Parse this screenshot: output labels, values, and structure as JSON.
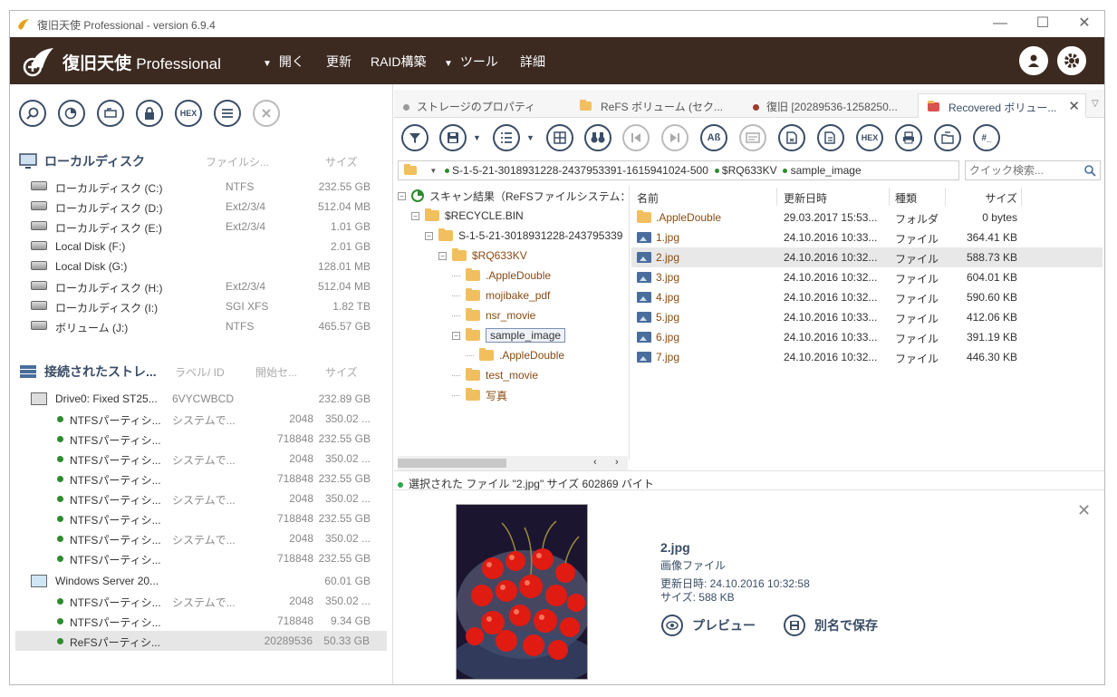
{
  "window": {
    "title": "復旧天使 Professional - version 6.9.4"
  },
  "brand": {
    "name": "復旧天使",
    "edition": "Professional"
  },
  "menu": [
    {
      "label": "開く",
      "arrow": "▼"
    },
    {
      "label": "更新",
      "arrow": ""
    },
    {
      "label": "RAID構築",
      "arrow": ""
    },
    {
      "label": "ツール",
      "arrow": "▼"
    },
    {
      "label": "詳細",
      "arrow": ""
    }
  ],
  "left_toolbar": [
    {
      "icon": "search-icon"
    },
    {
      "icon": "scan-icon"
    },
    {
      "icon": "image-file-icon"
    },
    {
      "icon": "lock-icon"
    },
    {
      "icon": "hex-icon",
      "label": "HEX"
    },
    {
      "icon": "list-icon"
    },
    {
      "icon": "close-icon"
    }
  ],
  "local_disks": {
    "title": "ローカルディスク",
    "col_fs": "ファイルシ...",
    "col_size": "サイズ",
    "items": [
      {
        "name": "ローカルディスク (C:)",
        "fs": "NTFS",
        "size": "232.55 GB"
      },
      {
        "name": "ローカルディスク (D:)",
        "fs": "Ext2/3/4",
        "size": "512.04 MB"
      },
      {
        "name": "ローカルディスク (E:)",
        "fs": "Ext2/3/4",
        "size": "1.01 GB"
      },
      {
        "name": "Local Disk (F:)",
        "fs": "",
        "size": "2.01 GB"
      },
      {
        "name": "Local Disk (G:)",
        "fs": "",
        "size": "128.01 MB"
      },
      {
        "name": "ローカルディスク (H:)",
        "fs": "Ext2/3/4",
        "size": "512.04 MB"
      },
      {
        "name": "ローカルディスク (I:)",
        "fs": "SGI XFS",
        "size": "1.82 TB"
      },
      {
        "name": "ボリューム (J:)",
        "fs": "NTFS",
        "size": "465.57 GB"
      }
    ]
  },
  "storages": {
    "title": "接続されたストレ...",
    "col_label": "ラベル/ ID",
    "col_start": "開始セ...",
    "col_size": "サイズ",
    "items": [
      {
        "type": "drive",
        "name": "Drive0: Fixed ST25...",
        "label": "6VYCWBCD",
        "start": "",
        "size": "232.89 GB"
      },
      {
        "type": "part",
        "name": "NTFSパーティシ...",
        "label": "システムで...",
        "start": "2048",
        "size": "350.02 ..."
      },
      {
        "type": "part",
        "name": "NTFSパーティシ...",
        "label": "",
        "start": "718848",
        "size": "232.55 GB"
      },
      {
        "type": "part",
        "name": "NTFSパーティシ...",
        "label": "システムで...",
        "start": "2048",
        "size": "350.02 ..."
      },
      {
        "type": "part",
        "name": "NTFSパーティシ...",
        "label": "",
        "start": "718848",
        "size": "232.55 GB"
      },
      {
        "type": "part",
        "name": "NTFSパーティシ...",
        "label": "システムで...",
        "start": "2048",
        "size": "350.02 ..."
      },
      {
        "type": "part",
        "name": "NTFSパーティシ...",
        "label": "",
        "start": "718848",
        "size": "232.55 GB"
      },
      {
        "type": "part",
        "name": "NTFSパーティシ...",
        "label": "システムで...",
        "start": "2048",
        "size": "350.02 ..."
      },
      {
        "type": "part",
        "name": "NTFSパーティシ...",
        "label": "",
        "start": "718848",
        "size": "232.55 GB"
      },
      {
        "type": "vdrive",
        "name": "Windows Server 20...",
        "label": "",
        "start": "",
        "size": "60.01 GB"
      },
      {
        "type": "part",
        "name": "NTFSパーティシ...",
        "label": "システムで...",
        "start": "2048",
        "size": "350.02 ..."
      },
      {
        "type": "part",
        "name": "NTFSパーティシ...",
        "label": "",
        "start": "718848",
        "size": "9.34 GB"
      },
      {
        "type": "part",
        "name": "ReFSパーティシ...",
        "label": "",
        "start": "20289536",
        "size": "50.33 GB",
        "selected": true
      }
    ]
  },
  "tabs": [
    {
      "label": "ストレージのプロパティ",
      "icon": "dot-icon"
    },
    {
      "label": "ReFS ボリューム (セク...",
      "icon": "folder-icon"
    },
    {
      "label": "復旧 [20289536-1258250...",
      "icon": "dot-red-icon"
    },
    {
      "label": "Recovered ボリュー...",
      "icon": "folder-red-icon",
      "active": true
    }
  ],
  "right_toolbar": [
    {
      "icon": "filter-icon"
    },
    {
      "icon": "save-icon"
    },
    {
      "icon": "checklist-icon"
    },
    {
      "icon": "grid-view-icon"
    },
    {
      "icon": "binoculars-icon"
    },
    {
      "icon": "prev-icon"
    },
    {
      "icon": "next-icon"
    },
    {
      "icon": "text-icon",
      "label": "Aß"
    },
    {
      "icon": "card-icon"
    },
    {
      "icon": "file-export-icon"
    },
    {
      "icon": "file-copy-icon"
    },
    {
      "icon": "hex-icon",
      "label": "HEX"
    },
    {
      "icon": "print-icon"
    },
    {
      "icon": "folder-copy-icon"
    },
    {
      "icon": "hash-icon",
      "label": "#_"
    }
  ],
  "path": {
    "seg1": "S-1-5-21-3018931228-2437953391-1615941024-500",
    "seg2": "$RQ633KV",
    "seg3": "sample_image"
  },
  "search": {
    "placeholder": "クイック検索..."
  },
  "tree": [
    {
      "label": "スキャン結果（ReFSファイルシステム：",
      "level": 0,
      "toggle": "⊟",
      "type": "root"
    },
    {
      "label": "$RECYCLE.BIN",
      "level": 1,
      "toggle": "⊟",
      "type": "folder"
    },
    {
      "label": "S-1-5-21-3018931228-243795339",
      "level": 2,
      "toggle": "⊟",
      "type": "folder"
    },
    {
      "label": "$RQ633KV",
      "level": 3,
      "toggle": "⊟",
      "type": "folder"
    },
    {
      "label": ".AppleDouble",
      "level": 4,
      "toggle": "",
      "type": "folder"
    },
    {
      "label": "mojibake_pdf",
      "level": 4,
      "toggle": "",
      "type": "folder"
    },
    {
      "label": "nsr_movie",
      "level": 4,
      "toggle": "",
      "type": "folder"
    },
    {
      "label": "sample_image",
      "level": 4,
      "toggle": "⊟",
      "type": "folder",
      "selected": true
    },
    {
      "label": ".AppleDouble",
      "level": 5,
      "toggle": "",
      "type": "folder"
    },
    {
      "label": "test_movie",
      "level": 4,
      "toggle": "",
      "type": "folder"
    },
    {
      "label": "写真",
      "level": 4,
      "toggle": "",
      "type": "folder"
    }
  ],
  "files": {
    "headers": {
      "name": "名前",
      "date": "更新日時",
      "type": "種類",
      "size": "サイズ"
    },
    "rows": [
      {
        "name": ".AppleDouble",
        "date": "29.03.2017 15:53...",
        "type": "フォルダ",
        "size": "0 bytes",
        "kind": "folder"
      },
      {
        "name": "1.jpg",
        "date": "24.10.2016 10:33...",
        "type": "ファイル",
        "size": "364.41 KB",
        "kind": "image"
      },
      {
        "name": "2.jpg",
        "date": "24.10.2016 10:32...",
        "type": "ファイル",
        "size": "588.73 KB",
        "kind": "image",
        "selected": true
      },
      {
        "name": "3.jpg",
        "date": "24.10.2016 10:32...",
        "type": "ファイル",
        "size": "604.01 KB",
        "kind": "image"
      },
      {
        "name": "4.jpg",
        "date": "24.10.2016 10:32...",
        "type": "ファイル",
        "size": "590.60 KB",
        "kind": "image"
      },
      {
        "name": "5.jpg",
        "date": "24.10.2016 10:33...",
        "type": "ファイル",
        "size": "412.06 KB",
        "kind": "image"
      },
      {
        "name": "6.jpg",
        "date": "24.10.2016 10:33...",
        "type": "ファイル",
        "size": "391.19 KB",
        "kind": "image"
      },
      {
        "name": "7.jpg",
        "date": "24.10.2016 10:32...",
        "type": "ファイル",
        "size": "446.30 KB",
        "kind": "image"
      }
    ]
  },
  "status": {
    "text": "選択された ファイル \"2.jpg\" サイズ 602869 バイト"
  },
  "preview": {
    "filename": "2.jpg",
    "filetype": "画像ファイル",
    "modified": "更新日時: 24.10.2016 10:32:58",
    "size": "サイズ: 588 KB",
    "preview_label": "プレビュー",
    "saveas_label": "別名で保存"
  },
  "colors": {
    "header_bg": "#3c2a21",
    "accent": "#3a4d66",
    "folder": "#f2bf5e",
    "status_green": "#2e8b2e",
    "link_brown": "#8a4b12"
  }
}
